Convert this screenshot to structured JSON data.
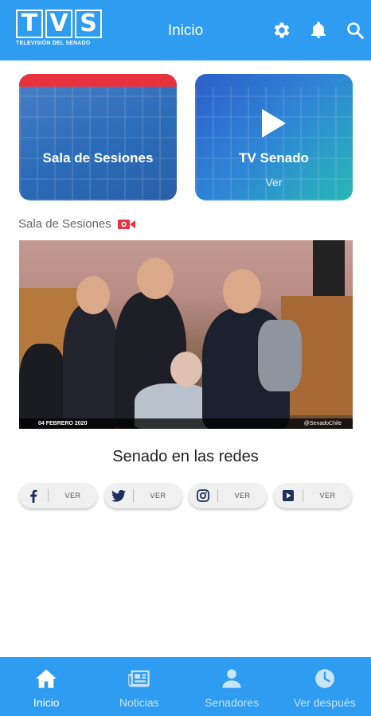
{
  "header": {
    "logo_letters": [
      "T",
      "V",
      "S"
    ],
    "logo_subtitle": "TELEVISIÓN DEL SENADO",
    "title": "Inicio",
    "icons": [
      "gear-icon",
      "bell-icon",
      "search-icon"
    ],
    "color": "#2e9cf0"
  },
  "cards": [
    {
      "title": "Sala de Sesiones",
      "subtitle": "",
      "accent": "#e8333e"
    },
    {
      "title": "TV Senado",
      "subtitle": "Ver"
    }
  ],
  "section": {
    "label": "Sala de Sesiones",
    "icon": "video-camera-icon",
    "icon_color": "#e8333e"
  },
  "video": {
    "date_overlay": "04 FEBRERO 2020",
    "handle_overlay": "@SenadoChile"
  },
  "social": {
    "title": "Senado en las redes",
    "buttons": [
      {
        "icon": "facebook-icon",
        "label": "VER"
      },
      {
        "icon": "twitter-icon",
        "label": "VER"
      },
      {
        "icon": "instagram-icon",
        "label": "VER"
      },
      {
        "icon": "youtube-icon",
        "label": "VER"
      }
    ]
  },
  "bottom_nav": {
    "items": [
      {
        "label": "Inicio",
        "icon": "home-icon",
        "active": true
      },
      {
        "label": "Noticias",
        "icon": "newspaper-icon",
        "active": false
      },
      {
        "label": "Senadores",
        "icon": "person-icon",
        "active": false
      },
      {
        "label": "Ver después",
        "icon": "clock-icon",
        "active": false
      }
    ]
  }
}
